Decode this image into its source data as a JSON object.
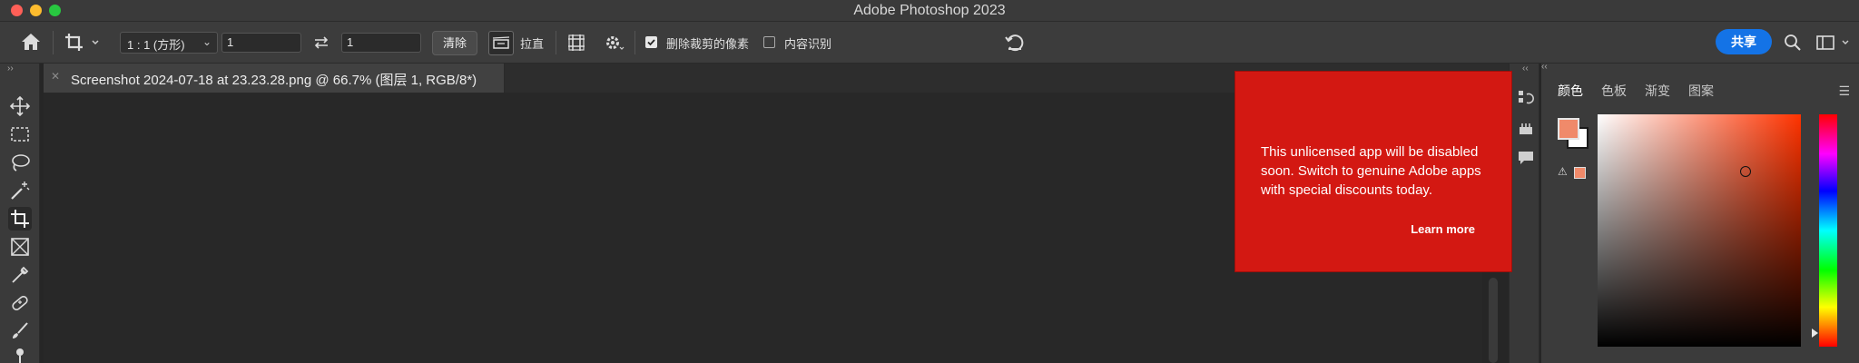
{
  "window": {
    "title": "Adobe Photoshop 2023"
  },
  "options_bar": {
    "aspect_ratio": "1 : 1 (方形)",
    "width_value": "1",
    "height_value": "1",
    "clear_label": "清除",
    "straighten_label": "拉直",
    "delete_cropped_label": "删除裁剪的像素",
    "delete_cropped_checked": true,
    "content_aware_label": "内容识别",
    "content_aware_checked": false,
    "share_label": "共享"
  },
  "document": {
    "tab_title": "Screenshot 2024-07-18 at 23.23.28.png @ 66.7% (图层 1, RGB/8*)"
  },
  "color_panel": {
    "tabs": [
      {
        "label": "颜色",
        "active": true
      },
      {
        "label": "色板",
        "active": false
      },
      {
        "label": "渐变",
        "active": false
      },
      {
        "label": "图案",
        "active": false
      }
    ],
    "foreground_color": "#f08a6a",
    "background_color": "#ffffff",
    "hue_color": "#ff3300"
  },
  "notification": {
    "message": "This unlicensed app will be disabled soon. Switch to genuine Adobe apps with special discounts today.",
    "link_label": "Learn more",
    "background": "#d31812"
  },
  "toolbar": {
    "tools": [
      "move-tool",
      "marquee-tool",
      "lasso-tool",
      "magic-wand-tool",
      "crop-tool",
      "frame-tool",
      "eyedropper-tool",
      "healing-tool",
      "brush-tool",
      "clone-stamp-tool"
    ],
    "active_tool": "crop-tool"
  }
}
